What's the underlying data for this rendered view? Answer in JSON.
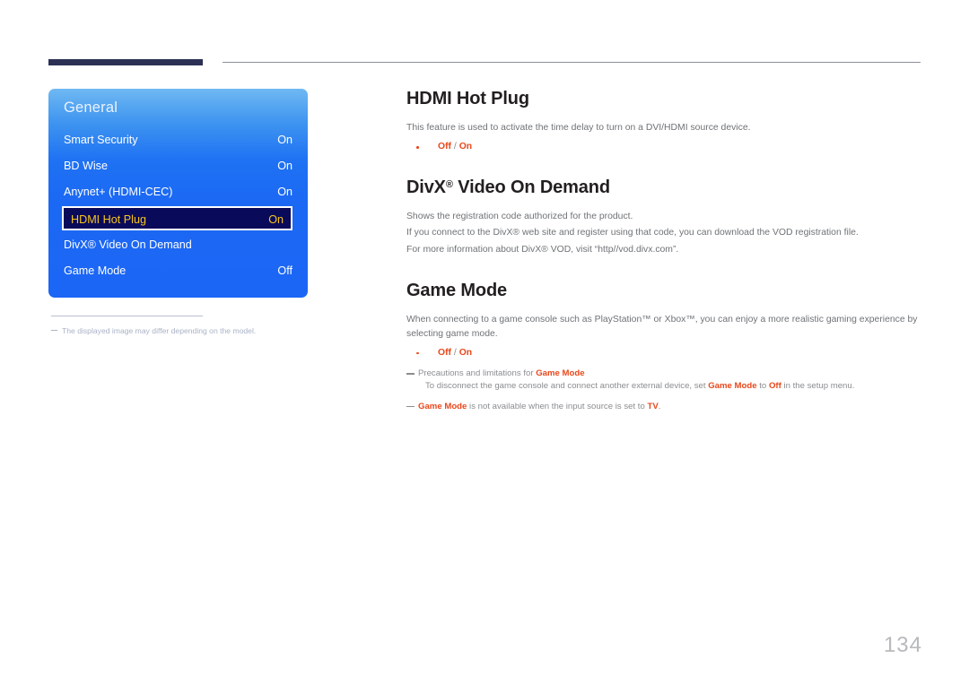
{
  "header": {
    "accent_color": "#2c3055",
    "rule_color": "#8d8f9b"
  },
  "osd_panel": {
    "title": "General",
    "accent_blue": "#1c66f5",
    "highlight_bg": "#0a0a5a",
    "highlight_text": "#f7c51d",
    "rows": [
      {
        "label": "Smart Security",
        "value": "On",
        "selected": false
      },
      {
        "label": "BD Wise",
        "value": "On",
        "selected": false
      },
      {
        "label": "Anynet+ (HDMI-CEC)",
        "value": "On",
        "selected": false
      },
      {
        "label": "HDMI Hot Plug",
        "value": "On",
        "selected": true
      },
      {
        "label": "DivX® Video On Demand",
        "value": "",
        "selected": false
      },
      {
        "label": "Game Mode",
        "value": "Off",
        "selected": false
      }
    ]
  },
  "figure_note": {
    "text": "The displayed image may differ depending on the model."
  },
  "content": {
    "section1": {
      "heading": "HDMI Hot Plug",
      "paragraph": "This feature is used to activate the time delay to turn on a DVI/HDMI source device.",
      "option_a": "Off",
      "option_sep": "/",
      "option_b": "On"
    },
    "section2": {
      "heading_main": "DivX",
      "heading_sup": "®",
      "heading_rest": " Video On Demand",
      "line1": "Shows the registration code authorized for the product.",
      "line2": "If you connect to the DivX® web site and register using that code, you can download the VOD registration file.",
      "line3": "For more information about DivX® VOD, visit “http//vod.divx.com”."
    },
    "section3": {
      "heading": "Game Mode",
      "paragraph": "When connecting to a game console such as PlayStation™ or Xbox™, you can enjoy a more realistic gaming experience by selecting game mode.",
      "option_a": "Off",
      "option_sep": "/",
      "option_b": "On",
      "note1_pre": "Precautions and limitations for ",
      "note1_em": "Game Mode",
      "note1_sub_pre": "To disconnect the game console and connect another external device, set ",
      "note1_sub_em1": "Game Mode",
      "note1_sub_mid": " to ",
      "note1_sub_em2": "Off",
      "note1_sub_post": " in the setup menu.",
      "note2_em1": "Game Mode",
      "note2_mid": " is not available when the input source is set to ",
      "note2_em2": "TV",
      "note2_post": "."
    }
  },
  "page_number": "134"
}
